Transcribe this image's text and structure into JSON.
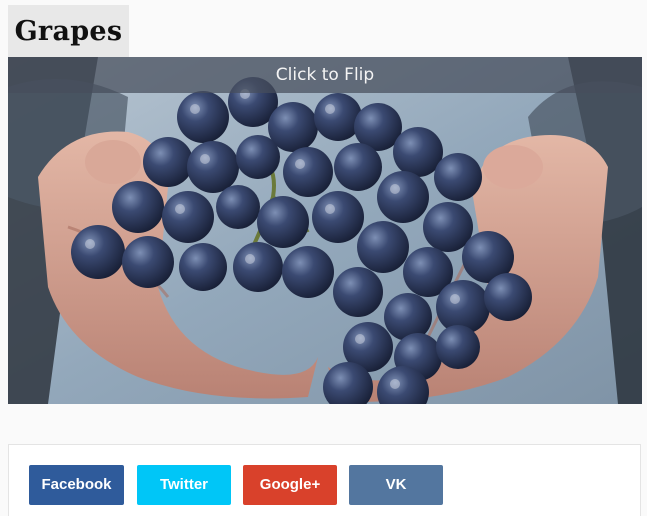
{
  "card": {
    "title": "Grapes",
    "flip_hint": "Click to Flip",
    "image_subject": "hands holding a bunch of dark blue grapes"
  },
  "share": {
    "buttons": [
      {
        "label": "Facebook",
        "color": "#2f5b9b"
      },
      {
        "label": "Twitter",
        "color": "#00c6f7"
      },
      {
        "label": "Google+",
        "color": "#d9412b"
      },
      {
        "label": "VK",
        "color": "#53769f"
      }
    ]
  }
}
